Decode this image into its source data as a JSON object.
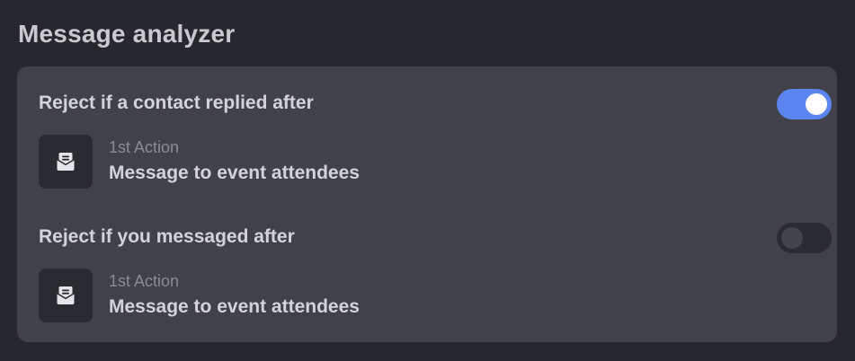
{
  "section": {
    "title": "Message analyzer"
  },
  "rules": [
    {
      "title": "Reject if a contact replied after",
      "enabled": true,
      "action": {
        "kicker": "1st Action",
        "label": "Message to event attendees",
        "icon": "envelope-open-icon"
      }
    },
    {
      "title": "Reject if you messaged after",
      "enabled": false,
      "action": {
        "kicker": "1st Action",
        "label": "Message to event attendees",
        "icon": "envelope-open-icon"
      }
    }
  ],
  "colors": {
    "background": "#27282d",
    "card": "#404149",
    "toggle_on": "#5b84f0",
    "toggle_off": "#2a2b31"
  }
}
